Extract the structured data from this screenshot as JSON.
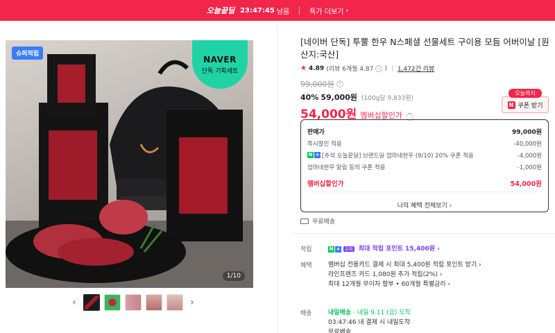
{
  "promo": {
    "logo": "오늘끝딜",
    "timer": "23:47:45",
    "timer_suffix": "남음",
    "more_label": "특가 더보기",
    "bg_color": "#f2254a"
  },
  "gallery": {
    "badge": "슈퍼적립",
    "naver_tag_line1": "NAVER",
    "naver_tag_line2": "단독 기획세트",
    "page_indicator": "1/10",
    "prev_icon": "chevron-left",
    "next_icon": "chevron-right",
    "thumbnail_count": 5,
    "active_thumbnail": 1
  },
  "product": {
    "title": "[네이버 단독] 투뿔 한우 N스페셜 선물세트 구이용 모듬 어버이날 [원산지:국산]",
    "rating": "4.89",
    "rating_detail": "(리뷰 6개월 4.87",
    "review_count": "1,472건 리뷰",
    "original_price": "99,000원",
    "discount_pct": "40%",
    "discount_price": "59,000원",
    "unit_price": "(100g당 9,833원)",
    "member_price": "54,000원",
    "member_label": "멤버십할인가",
    "accent": "#f2254a"
  },
  "coupon": {
    "today": "오늘까지",
    "button": "쿠폰 받기"
  },
  "breakdown": {
    "rows": [
      {
        "label": "판매가",
        "value": "99,000원"
      },
      {
        "label": "즉시할인 적용",
        "value": "-40,000원"
      },
      {
        "label": "[추석 오늘끝딜] 브랜드딜 엄마네한우 (9/10) 20% 쿠폰 적용",
        "value": "-4,000원"
      },
      {
        "label": "엄마네한우 알림 동의 쿠폰 적용",
        "value": "-1,000원"
      }
    ],
    "total_label": "멤버십할인가",
    "total_value": "54,000원",
    "all_benefits": "나의 혜택 전체보기"
  },
  "shipping": {
    "label": "무료배송"
  },
  "points": {
    "key": "적립",
    "super_tag": "슈퍼",
    "text": "최대 적립 포인트 15,400원"
  },
  "benefits": {
    "key": "혜택",
    "lines": [
      "멤버십 전용카드 결제 시 최대 5,400원 적립 포인트 받기",
      "라인프렌즈 카드 1,080원 추가 적립(2%)",
      "최대 12개월 무이자 할부 • 60개월 특별금리"
    ]
  },
  "delivery": {
    "key": "배송",
    "badge": "내일배송",
    "date": "· 내일 9.11 (금) 도착",
    "note": "03:47:46  내 결제 시 내일도착",
    "extra": "무료배송"
  }
}
